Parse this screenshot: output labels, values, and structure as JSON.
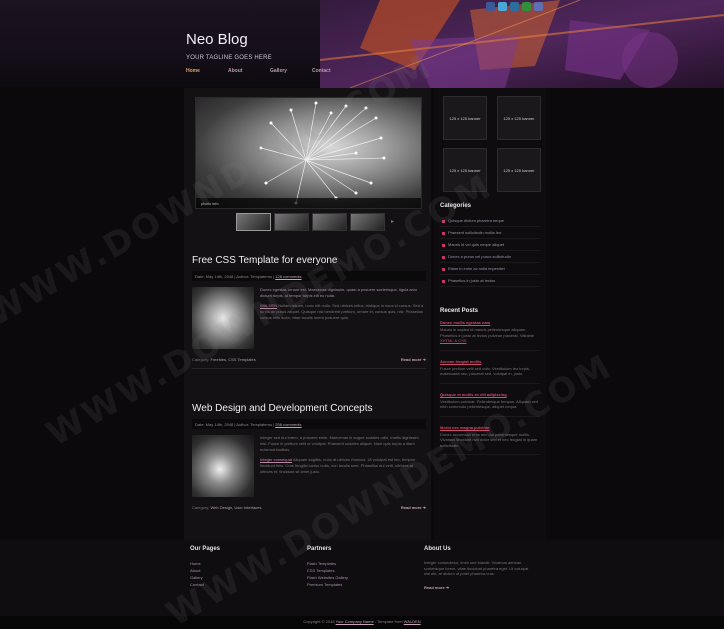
{
  "social": {
    "icons": [
      "facebook-icon",
      "twitter-icon",
      "linkedin-icon",
      "myspace-icon",
      "rss-icon"
    ],
    "colors": [
      "#3b5998",
      "#4aa8d8",
      "#2a6ea0",
      "#2f8f3a",
      "#5d6fb5"
    ]
  },
  "header": {
    "site_title": "Neo Blog",
    "tagline": "YOUR TAGLINE GOES HERE"
  },
  "nav": {
    "items": [
      "Home",
      "About",
      "Gallery",
      "Contact"
    ],
    "active": "Home"
  },
  "slider": {
    "caption": "photo info"
  },
  "posts": [
    {
      "title": "Free CSS Template for everyone",
      "meta_date": "Date: May 14th, 2048 | Author: Templatemo |",
      "meta_link": "128 comments",
      "intro": "Donec egestas ornare est. Maecenas dignissim, quam a posuere scelerisque, ligula arcu dictum turpis, id tempor turpis elit eu nulla.",
      "body_link": "WALDEN",
      "body": "Nullam rutrum, nunc elit nulla. Sed ultrices tellus, tristique in risus id cursus. Sed a turpis ac purus aliquet. Quisque nisi hendrerit pretium, ornare in, cursus quis, nisl. Phasellus cursus felis dolor, vitae iaculis lorem posuere quis.",
      "category_label": "Category:",
      "categories": "Freebies, CSS Templates",
      "read_more": "Read more ➔"
    },
    {
      "title": "Web Design and Development Concepts",
      "meta_date": "Date: May 14th, 2048 | Author: Templatemo |",
      "meta_link": "256 comments",
      "intro": "Integer sed dui lorem, a posuere enim. Maecenas in augue sodales odio, mattis dignissim nisl. Fusce in pretium velit ut volutpat. Praesent sodales aliquet. Nam quis turpis a diam euismod facilisis.",
      "body_link": "Integer consequat",
      "body": "Aliquam sagittis, nunc at ultrices rhoncus. Ut volutpat est leo, tempus tincidunt felis. Cras fringilla luctus nulla, non iaculis sem. Phasellus dui velit, ultricies at ultrices et, tincidunt sit amet justo.",
      "category_label": "Category:",
      "categories": "Web Design, User Interfaces",
      "read_more": "Read more ➔"
    }
  ],
  "banners": [
    "125 x 125 banner",
    "125 x 125 banner",
    "125 x 125 banner",
    "125 x 125 banner"
  ],
  "categories": {
    "title": "Categories",
    "items": [
      "Quisque dictum pharetra neque",
      "Praesent sollicitudin mollis leo",
      "Mauris id vel quis neque aliquet",
      "Donec a purus vel purus sollicitudin",
      "Etiam in enim ac nulla imperdiet",
      "Phasellus in justo at lectus"
    ]
  },
  "recent": {
    "title": "Recent Posts",
    "items": [
      {
        "title": "Donec mollis egestas nam",
        "text": "Mauris in sapien id mauris pellentesque aliquam. Phasellus in justo at lectus pulvinar placerat. Validate",
        "links": "XHTML & CSS"
      },
      {
        "title": "Aenean feugiat mollis",
        "text": "Fusce pretium velit sed odio. Vestibulum leo turpis, malesuada nec, placerat sed, volutpat in, justo.",
        "links": ""
      },
      {
        "title": "Quisque et mollis ex elit adipiscing",
        "text": "Vestibulum pulvinar. Pellentesque tempus. Aliquam sed nibh commodo pellentesque, aliquet nequa.",
        "links": ""
      },
      {
        "title": "Morbi nec magna pulvinar",
        "text": "Donec accumsan eros nec dui pellentesque mollis. Vivamus tincidunt non dolor sed et nec feugiat in quam sollicitudin.",
        "links": ""
      }
    ]
  },
  "footer": {
    "pages_title": "Our Pages",
    "pages": [
      "Home",
      "About",
      "Gallery",
      "Contact"
    ],
    "partners_title": "Partners",
    "partners": [
      "Flash Templates",
      "CSS Templates",
      "Flash Websites Gallery",
      "Premium Templates"
    ],
    "about_title": "About Us",
    "about_text": "Integer consectetur, enim sed blandit. Vivamus aenean scelerisque lorem, vitae tincidunt pharetra eget. Ut volutpat nisl elit, at dictum ut potet pharetra cras.",
    "about_more": "Read more ➔",
    "copyright": "Copyright © 2048",
    "company": "Your Company Name",
    "designed": "- Template from",
    "designer": "WALDEN"
  },
  "watermark": "WWW.DOWNDEMO.COM"
}
